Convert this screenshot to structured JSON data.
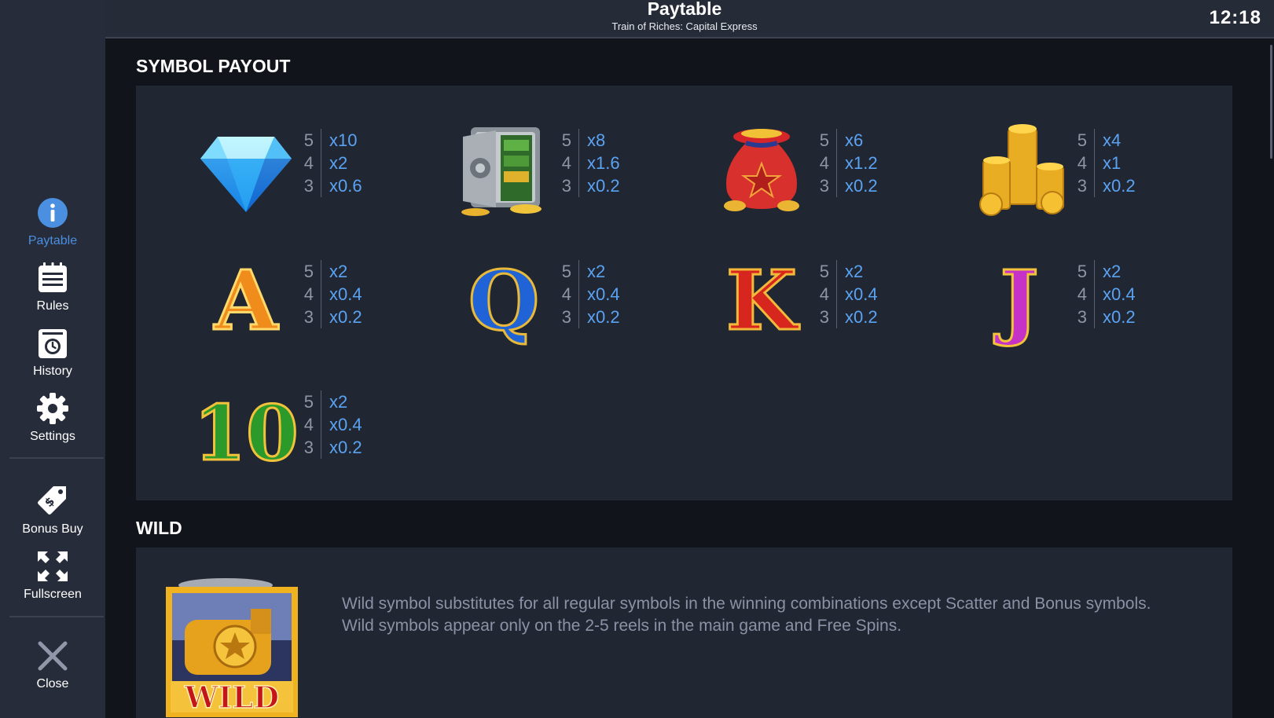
{
  "header": {
    "title": "Paytable",
    "subtitle": "Train of Riches: Capital Express",
    "clock": "12:18"
  },
  "sidebar": {
    "items": [
      {
        "label": "Paytable",
        "icon": "info-icon",
        "active": true
      },
      {
        "label": "Rules",
        "icon": "rules-icon"
      },
      {
        "label": "History",
        "icon": "history-icon"
      },
      {
        "label": "Settings",
        "icon": "gear-icon"
      },
      {
        "label": "Bonus Buy",
        "icon": "tag-icon"
      },
      {
        "label": "Fullscreen",
        "icon": "fullscreen-icon"
      },
      {
        "label": "Close",
        "icon": "close-icon"
      }
    ]
  },
  "colors": {
    "accent": "#4a8fe0",
    "multiplier": "#5aa3f3",
    "sidebar_bg": "#272c3a",
    "panel_bg": "#212633"
  },
  "symbol_payout": {
    "title": "SYMBOL PAYOUT",
    "symbols": [
      {
        "name": "diamond",
        "pays": [
          {
            "count": "5",
            "mult": "x10"
          },
          {
            "count": "4",
            "mult": "x2"
          },
          {
            "count": "3",
            "mult": "x0.6"
          }
        ]
      },
      {
        "name": "safe",
        "pays": [
          {
            "count": "5",
            "mult": "x8"
          },
          {
            "count": "4",
            "mult": "x1.6"
          },
          {
            "count": "3",
            "mult": "x0.2"
          }
        ]
      },
      {
        "name": "money-bag",
        "pays": [
          {
            "count": "5",
            "mult": "x6"
          },
          {
            "count": "4",
            "mult": "x1.2"
          },
          {
            "count": "3",
            "mult": "x0.2"
          }
        ]
      },
      {
        "name": "coins",
        "pays": [
          {
            "count": "5",
            "mult": "x4"
          },
          {
            "count": "4",
            "mult": "x1"
          },
          {
            "count": "3",
            "mult": "x0.2"
          }
        ]
      },
      {
        "name": "letter-a",
        "glyph": "A",
        "pays": [
          {
            "count": "5",
            "mult": "x2"
          },
          {
            "count": "4",
            "mult": "x0.4"
          },
          {
            "count": "3",
            "mult": "x0.2"
          }
        ]
      },
      {
        "name": "letter-q",
        "glyph": "Q",
        "pays": [
          {
            "count": "5",
            "mult": "x2"
          },
          {
            "count": "4",
            "mult": "x0.4"
          },
          {
            "count": "3",
            "mult": "x0.2"
          }
        ]
      },
      {
        "name": "letter-k",
        "glyph": "K",
        "pays": [
          {
            "count": "5",
            "mult": "x2"
          },
          {
            "count": "4",
            "mult": "x0.4"
          },
          {
            "count": "3",
            "mult": "x0.2"
          }
        ]
      },
      {
        "name": "letter-j",
        "glyph": "J",
        "pays": [
          {
            "count": "5",
            "mult": "x2"
          },
          {
            "count": "4",
            "mult": "x0.4"
          },
          {
            "count": "3",
            "mult": "x0.2"
          }
        ]
      },
      {
        "name": "number-10",
        "glyph": "10",
        "pays": [
          {
            "count": "5",
            "mult": "x2"
          },
          {
            "count": "4",
            "mult": "x0.4"
          },
          {
            "count": "3",
            "mult": "x0.2"
          }
        ]
      }
    ]
  },
  "wild": {
    "title": "WILD",
    "badge_text": "WILD",
    "description_1": "Wild symbol substitutes for all regular symbols in the winning combinations except Scatter and Bonus symbols.",
    "description_2": "Wild symbols appear only on the 2-5 reels in the main game and Free Spins."
  }
}
